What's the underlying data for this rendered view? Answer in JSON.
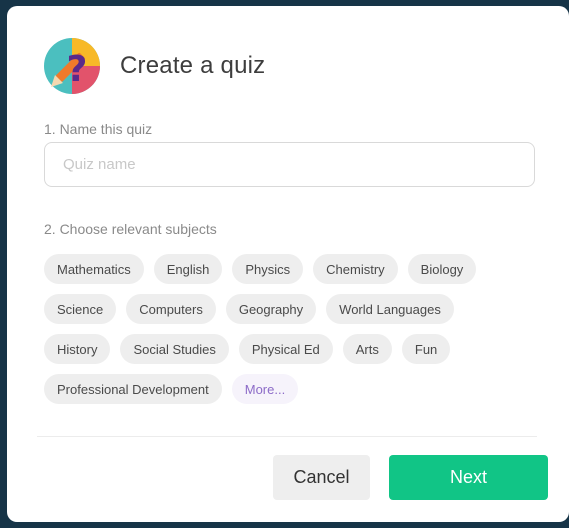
{
  "dialog": {
    "title": "Create a quiz",
    "logo_icon": "quiz-question-pencil-icon",
    "name_label": "1. Name this quiz",
    "name_placeholder": "Quiz name",
    "name_value": "",
    "subjects_label": "2. Choose relevant subjects",
    "subjects": [
      [
        "Mathematics",
        "English",
        "Physics",
        "Chemistry",
        "Biology"
      ],
      [
        "Science",
        "Computers",
        "Geography",
        "World Languages"
      ],
      [
        "History",
        "Social Studies",
        "Physical Ed",
        "Arts",
        "Fun"
      ],
      [
        "Professional Development",
        "More..."
      ]
    ],
    "cancel_label": "Cancel",
    "next_label": "Next"
  },
  "colors": {
    "backdrop": "#163447",
    "next_button": "#11c586",
    "chip_bg": "#eeeeee",
    "more_text": "#8c6bc8"
  }
}
